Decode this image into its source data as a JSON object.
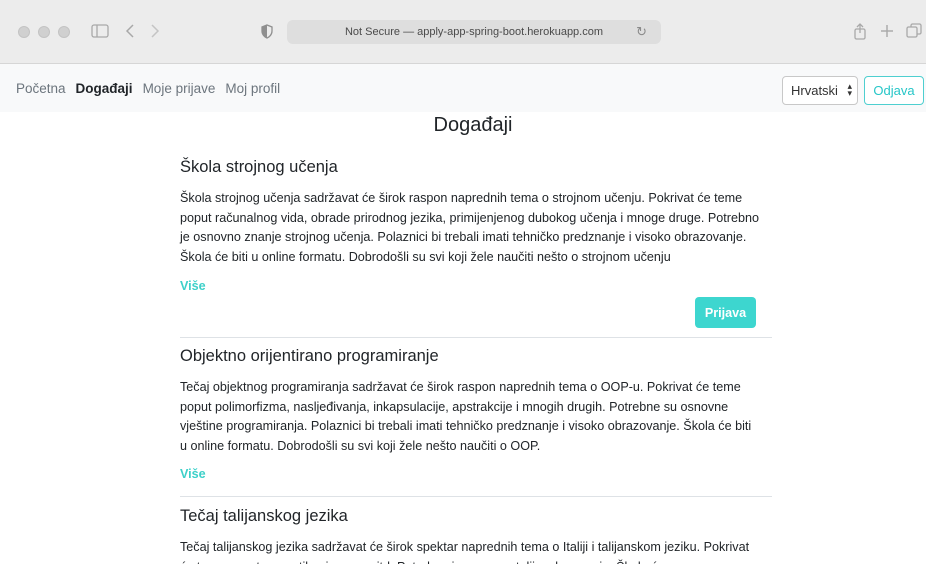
{
  "browser": {
    "url_text": "Not Secure — apply-app-spring-boot.herokuapp.com"
  },
  "nav": {
    "links": [
      "Početna",
      "Događaji",
      "Moje prijave",
      "Moj profil"
    ],
    "language": "Hrvatski",
    "logout_label": "Odjava"
  },
  "page": {
    "title": "Događaji"
  },
  "events": [
    {
      "title": "Škola strojnog učenja",
      "description": "Škola strojnog učenja sadržavat će širok raspon naprednih tema o strojnom učenju. Pokrivat će teme poput računalnog vida, obrade prirodnog jezika, primijenjenog dubokog učenja i mnoge druge. Potrebno je osnovno znanje strojnog učenja. Polaznici bi trebali imati tehničko predznanje i visoko obrazovanje. Škola će biti u online formatu. Dobrodošli su svi koji žele naučiti nešto o strojnom učenju",
      "more_label": "Više",
      "apply_label": "Prijava"
    },
    {
      "title": "Objektno orijentirano programiranje",
      "description": "Tečaj objektnog programiranja sadržavat će širok raspon naprednih tema o OOP-u. Pokrivat će teme poput polimorfizma, nasljeđivanja, inkapsulacije, apstrakcije i mnogih drugih. Potrebne su osnovne vještine programiranja. Polaznici bi trebali imati tehničko predznanje i visoko obrazovanje. Škola će biti u online formatu. Dobrodošli su svi koji žele nešto naučiti o OOP.",
      "more_label": "Više"
    },
    {
      "title": "Tečaj talijanskog jezika",
      "description": "Tečaj talijanskog jezika sadržavat će širok spektar naprednih tema o Italiji i talijanskom jeziku. Pokrivat će teme poput gramatike, izgovora itd. Potrebno je osnovno talijansko znanje. Škola će"
    }
  ]
}
